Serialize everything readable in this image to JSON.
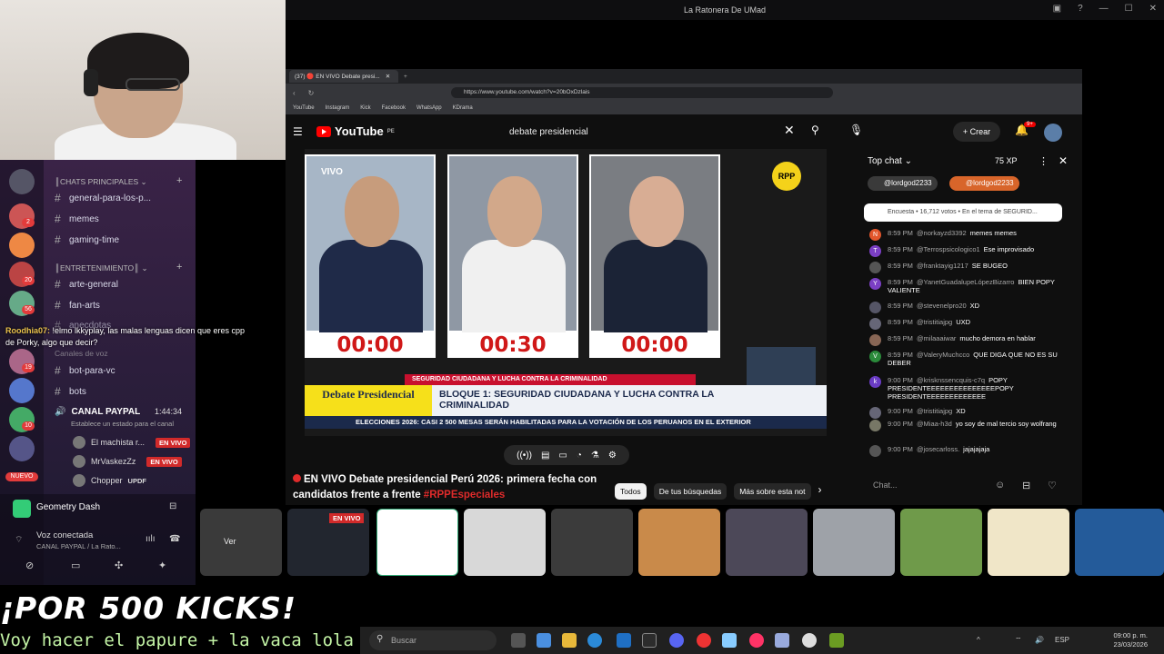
{
  "window_title": "La Ratonera De UMad",
  "browser": {
    "tab_title": "(37) 🔴 EN VIVO Debate presi...",
    "url": "https://www.youtube.com/watch?v=20bOxDzlais",
    "bookmarks": [
      "YouTube",
      "Instagram",
      "Kick",
      "Facebook",
      "WhatsApp",
      "KDrama"
    ]
  },
  "youtube": {
    "logo": "YouTube",
    "logo_country": "PE",
    "search_value": "debate presidencial",
    "create_label": "Crear",
    "notif_count": "9+",
    "video": {
      "vivo_label": "VIVO",
      "rpp_logo": "RPP",
      "timers": [
        "00:00",
        "00:30",
        "00:00"
      ],
      "red_bar": "SEGURIDAD CIUDADANA Y LUCHA CONTRA LA CRIMINALIDAD",
      "lower_left": "Debate Presidencial",
      "lower_right": "BLOQUE 1: SEGURIDAD CIUDADANA Y LUCHA CONTRA LA CRIMINALIDAD",
      "ticker": "ELECCIONES 2026: CASI 2 500 MESAS SERÁN HABILITADAS PARA LA VOTACIÓN DE LOS PERUANOS EN EL EXTERIOR"
    },
    "title_main": "EN VIVO Debate presidencial Perú 2026: primera fecha con candidatos frente a frente",
    "title_hashtag": "#RPPEspeciales",
    "chips": [
      "Todos",
      "De tus búsquedas",
      "Más sobre esta not"
    ],
    "chat": {
      "header": "Top chat",
      "xp": "75 XP",
      "pills": [
        "@lordgod2233",
        "@lordgod2233"
      ],
      "poll": "Encuesta • 16,712 votos • En el tema de SEGURID...",
      "messages": [
        {
          "time": "8:59 PM",
          "user": "@norkayzd3392",
          "text": "memes memes",
          "initial": "N",
          "color": "#e2562b"
        },
        {
          "time": "8:59 PM",
          "user": "@Terrospsicologico1",
          "text": "Ese improvisado",
          "initial": "T",
          "color": "#7b3fc4"
        },
        {
          "time": "8:59 PM",
          "user": "@franktayig1217",
          "text": "SE BUGEO",
          "initial": "",
          "color": "#555"
        },
        {
          "time": "8:59 PM",
          "user": "@YanetGuadalupeLópezBizarro",
          "text": "BIEN POPY VALIENTE",
          "initial": "Y",
          "color": "#7b3fc4"
        },
        {
          "time": "8:59 PM",
          "user": "@stevenelpro20",
          "text": "XD",
          "initial": "",
          "color": "#556"
        },
        {
          "time": "8:59 PM",
          "user": "@tristitiajpg",
          "text": "UXD",
          "initial": "",
          "color": "#667"
        },
        {
          "time": "8:59 PM",
          "user": "@milaaaiwar",
          "text": "mucho demora en hablar",
          "initial": "",
          "color": "#865"
        },
        {
          "time": "8:59 PM",
          "user": "@ValeryMuchcco",
          "text": "QUE DIGA QUE NO ES SU DEBER",
          "initial": "V",
          "color": "#2a8a3a"
        },
        {
          "time": "9:00 PM",
          "user": "@krisknssencquis-c7q",
          "text": "POPY PRESIDENTEEEEEEEEEEEEEEEPOPY PRESIDENTEEEEEEEEEEEEE",
          "initial": "k",
          "color": "#6a3cc4"
        },
        {
          "time": "9:00 PM",
          "user": "@tristitiajpg",
          "text": "XD",
          "initial": "",
          "color": "#667"
        },
        {
          "time": "9:00 PM",
          "user": "@Miaa-h3d",
          "text": "yo soy de mal tercio soy wolfrang",
          "initial": "",
          "color": "#776"
        },
        {
          "time": "9:00 PM",
          "user": "@josecarloss.",
          "text": "jajajajaja",
          "initial": "",
          "color": "#555"
        }
      ],
      "input_placeholder": "Chat..."
    }
  },
  "discord": {
    "categories": [
      "CHATS PRINCIPALES",
      "ENTRETENIMIENTO",
      "Canales de voz"
    ],
    "channels": [
      "general-para-los-p...",
      "memes",
      "gaming-time",
      "arte-general",
      "fan-arts",
      "anecdotas",
      "bot-para-vc",
      "bots"
    ],
    "voice_channel": "CANAL PAYPAL",
    "voice_time": "1:44:34",
    "voice_status": "Establece un estado para el canal",
    "voice_users": [
      {
        "name": "El machista r...",
        "live": "EN VIVO"
      },
      {
        "name": "MrVaskezZz",
        "live": "EN VIVO"
      },
      {
        "name": "Chopper",
        "live": "UPDF"
      }
    ],
    "server_badges": [
      "2",
      "20",
      "56",
      "19",
      "10",
      "NUEVO"
    ],
    "chat_overlay_user": "Roodhia07:",
    "chat_overlay_text": "!elmo lkkyplay, las malas lenguas dicen que eres cpp de Porky, algo que decir?",
    "activity": "Geometry Dash",
    "voice_connected": "Voz conectada",
    "voice_connected_sub": "CANAL PAYPAL / La Rato...",
    "ver_label": "Ver",
    "stream_live": "EN VIVO"
  },
  "overlay": {
    "banner": "¡POR 500 KICKS!",
    "marquee": "Voy hacer el papure + la vaca lola"
  },
  "taskbar": {
    "search_placeholder": "Buscar",
    "language": "ESP",
    "time": "09:00 p. m.",
    "date": "23/03/2026"
  },
  "colors": {
    "youtube_bg": "#0f0f0f",
    "accent_red": "#e02b2b",
    "discord_bg": "#3a2347"
  }
}
